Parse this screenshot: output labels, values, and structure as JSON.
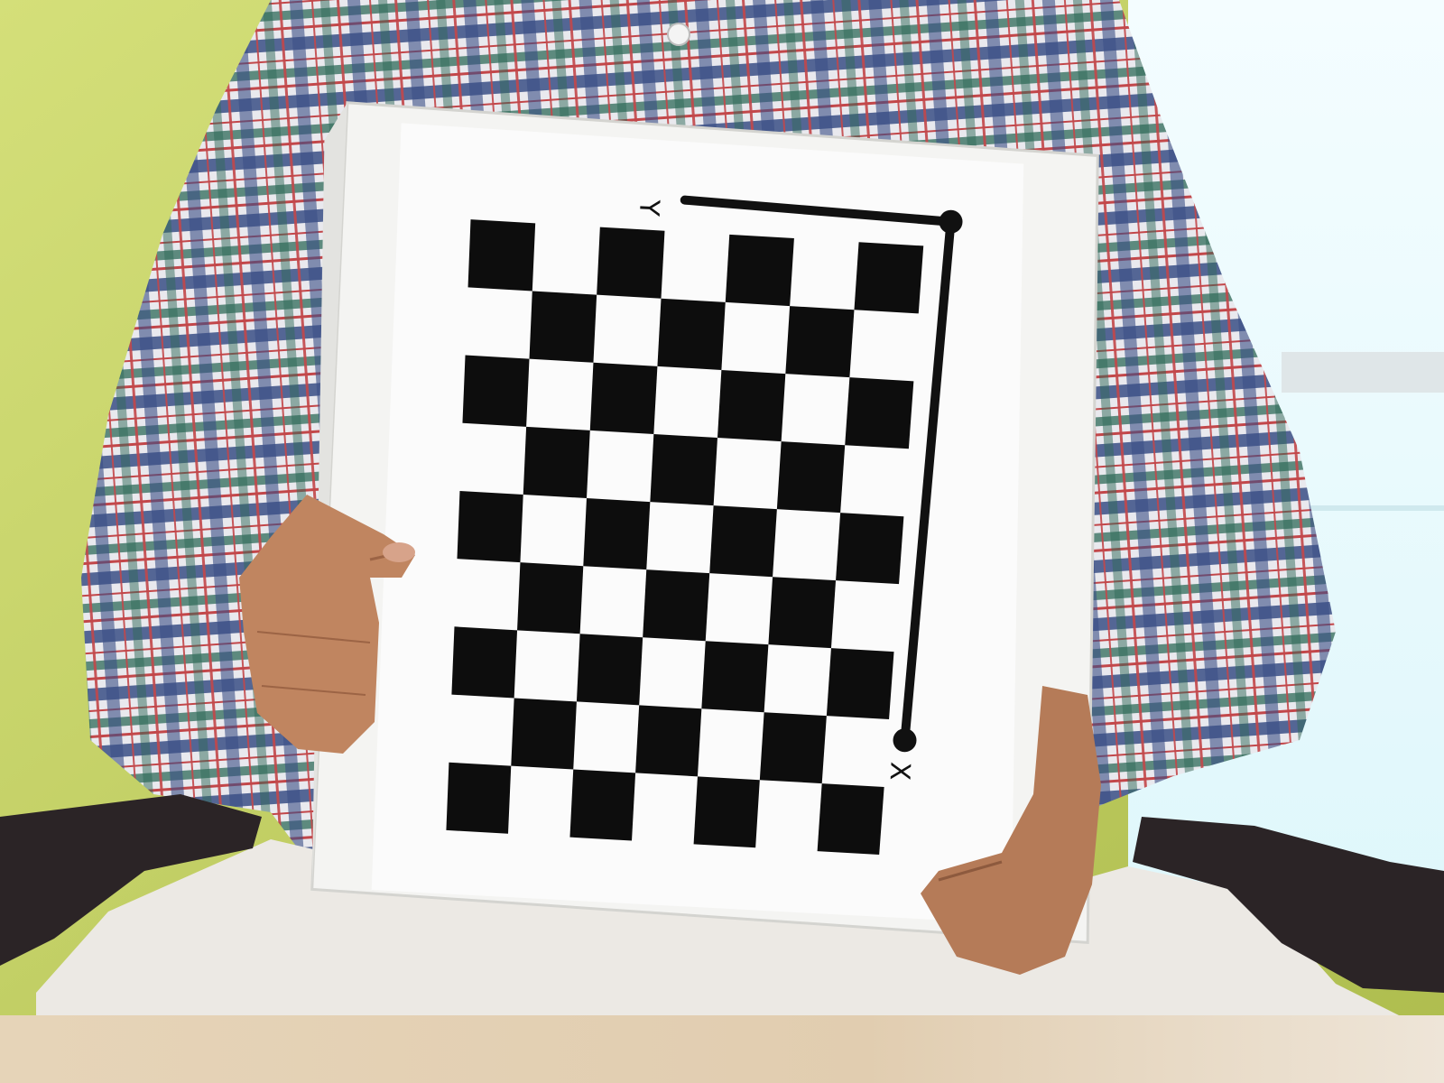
{
  "board": {
    "rows": 9,
    "cols": 7,
    "y_axis_label": "Y",
    "x_axis_label": "X"
  },
  "colors": {
    "wall": "#c8d56a",
    "wall_shadow": "#a9b748",
    "window": "#e9fbff",
    "shirt_base": "#e9e9ee",
    "shirt_blue": "#3a4f86",
    "shirt_red": "#c2474a",
    "shirt_green": "#2f6a58",
    "binder": "#f4f4f2",
    "paper": "#fbfbfb",
    "square_dark": "#0d0d0d",
    "pants": "#ece9e4",
    "chair": "#2b2426",
    "skin": "#c08560",
    "desk": "#e2d3bd"
  }
}
